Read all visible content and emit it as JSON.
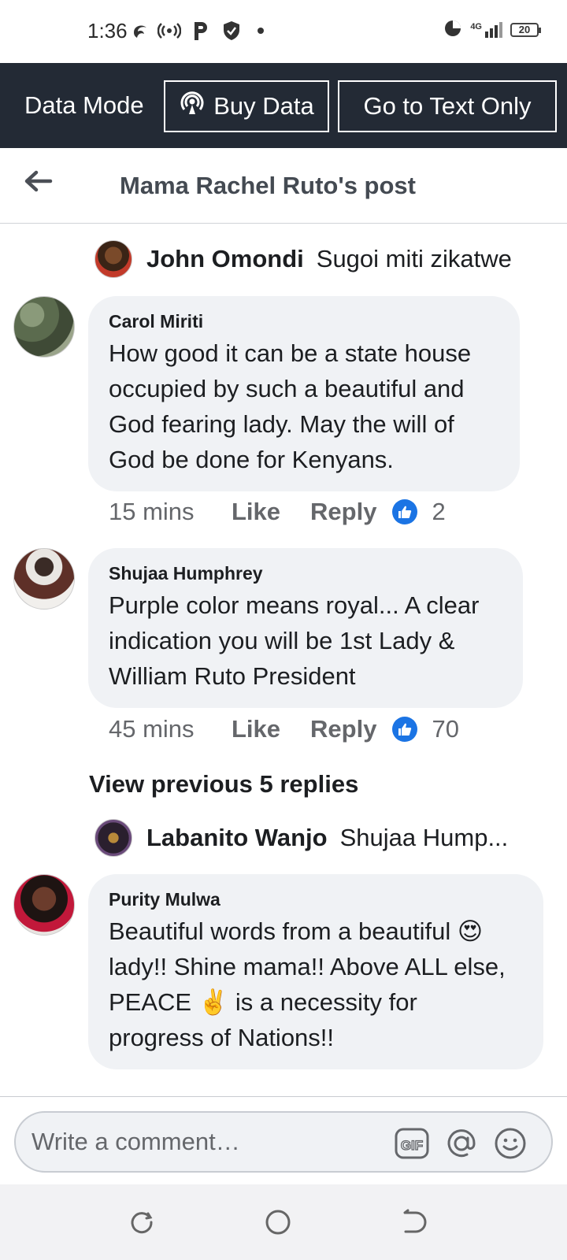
{
  "status_bar": {
    "time": "1:36",
    "battery": "20",
    "network": "4G"
  },
  "data_bar": {
    "label": "Data Mode",
    "buy_data": "Buy Data",
    "text_only": "Go to Text Only"
  },
  "header": {
    "title": "Mama Rachel Ruto's post"
  },
  "replies": [
    {
      "author": "John Omondi",
      "text": "Sugoi miti zikatwe"
    },
    {
      "author": "Labanito Wanjo",
      "text": "Shujaa Hump..."
    }
  ],
  "comments": [
    {
      "author": "Carol Miriti",
      "lines": [
        "How good it can be  a state house",
        "occupied by such  a beautiful and",
        "God fearing lady. May the will of",
        "God be done for Kenyans."
      ],
      "time": "15 mins",
      "like": "Like",
      "reply": "Reply",
      "reactions": "2"
    },
    {
      "author": "Shujaa Humphrey",
      "lines": [
        "Purple color means royal... A clear",
        "indication you will be 1st Lady &",
        "William Ruto President"
      ],
      "time": "45 mins",
      "like": "Like",
      "reply": "Reply",
      "reactions": "70"
    },
    {
      "author": "Purity Mulwa",
      "lines": [
        "Beautiful words from a beautiful 😍",
        "lady!! Shine mama!! Above ALL else,",
        "PEACE ✌️ is a necessity for",
        "progress of Nations!!"
      ]
    }
  ],
  "view_previous": "View previous 5 replies",
  "composer": {
    "placeholder": "Write a comment…"
  },
  "colors": {
    "data_bar_bg": "#232a35",
    "like_blue": "#1b74e4",
    "bubble_bg": "#f0f2f5"
  },
  "icons": [
    "signal-icon",
    "podcast-icon",
    "p-icon",
    "shield-icon",
    "back-arrow-icon",
    "thumbs-up-icon",
    "gif-icon",
    "mention-icon",
    "emoji-icon",
    "recent-apps-icon",
    "home-icon",
    "back-nav-icon"
  ]
}
